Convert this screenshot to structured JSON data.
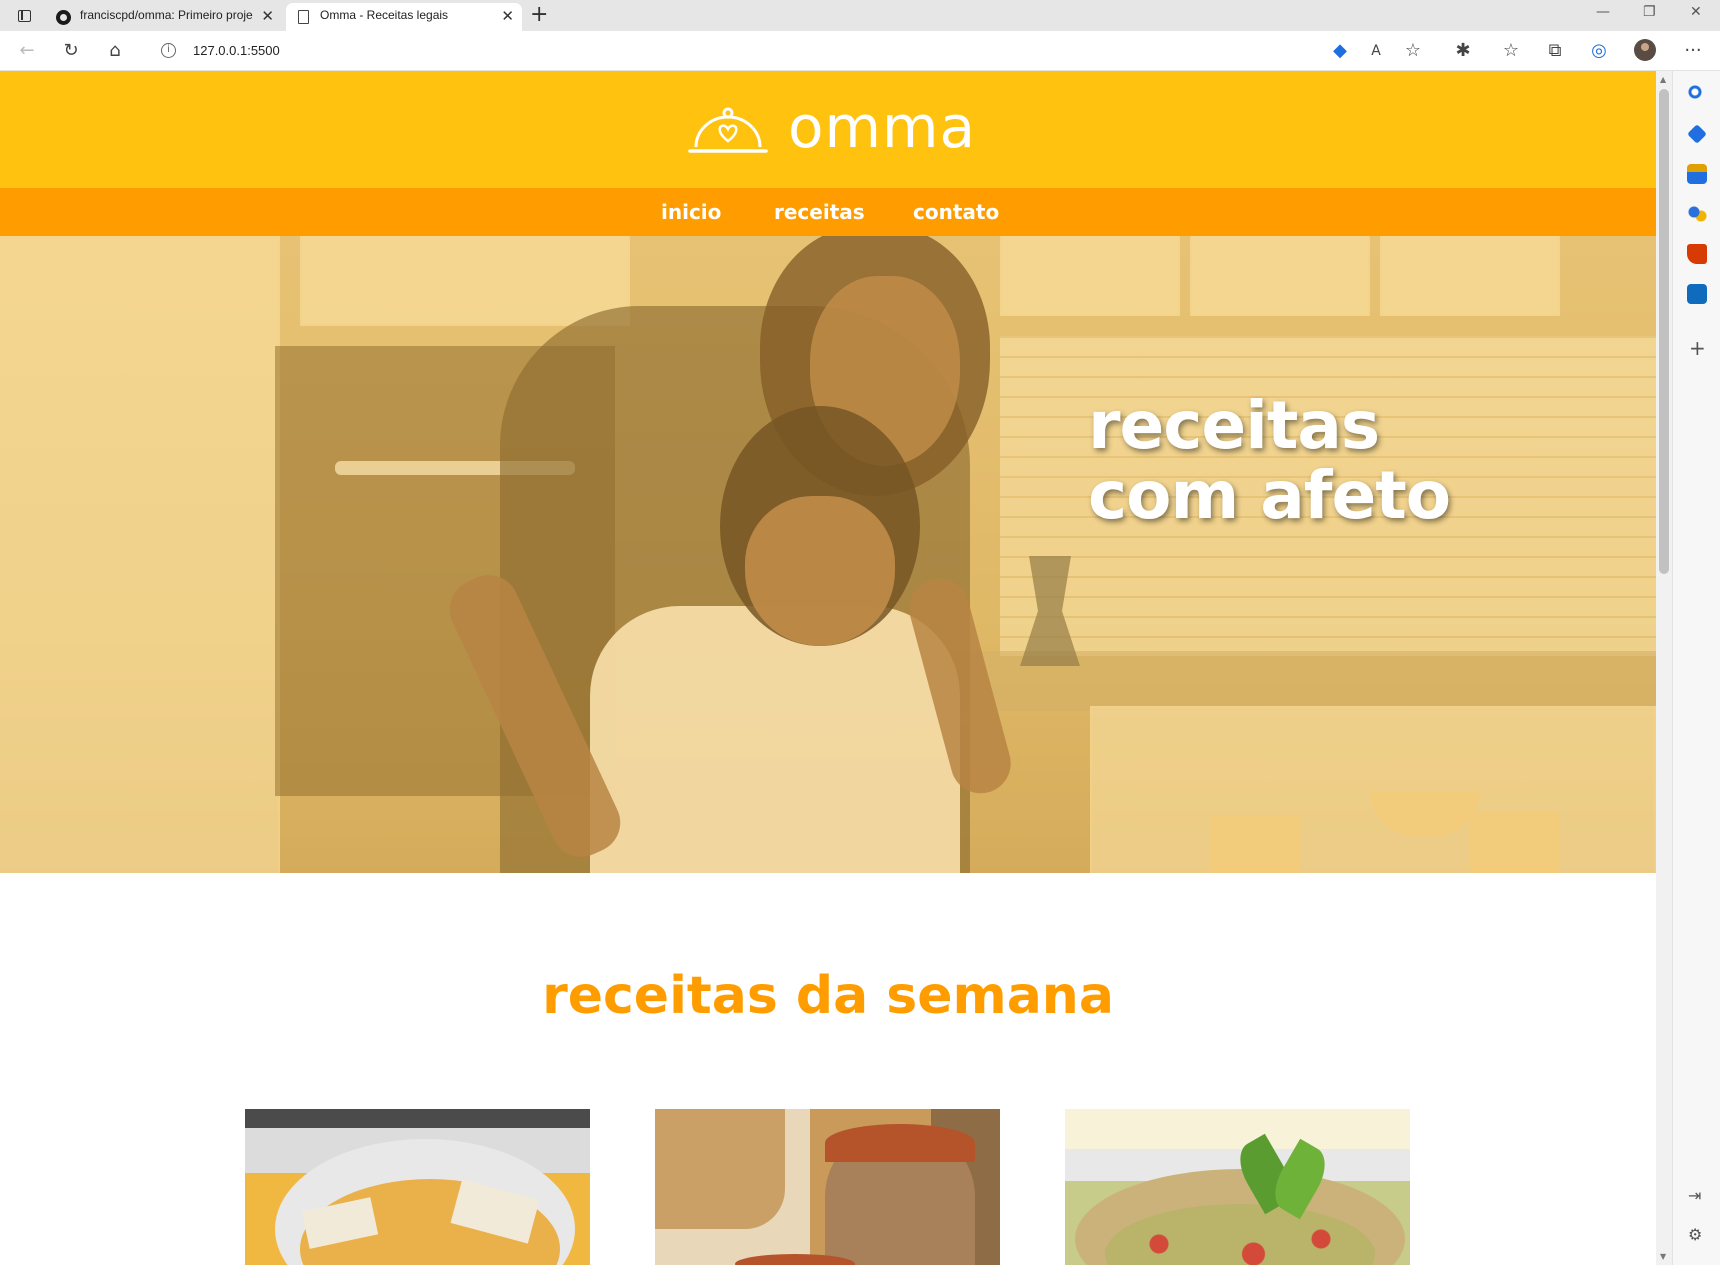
{
  "browser": {
    "tabs": [
      {
        "title": "franciscpd/omma: Primeiro proje",
        "close": "✕"
      },
      {
        "title": "Omma - Receitas legais",
        "close": "✕"
      }
    ],
    "new_tab": "+",
    "window_controls": {
      "minimize": "—",
      "restore": "❐",
      "close": "✕"
    },
    "address": {
      "url": "127.0.0.1:5500",
      "info_icon": "i"
    },
    "toolbar_icons": [
      "back-icon",
      "refresh-icon",
      "home-icon",
      "shopping-tag-icon",
      "read-aloud-icon",
      "add-favorite-icon",
      "extensions-icon",
      "favorites-icon",
      "collections-icon",
      "browser-essentials-icon",
      "profile-avatar",
      "more-icon"
    ],
    "sidebar_icons": [
      "search-icon",
      "shopping-icon",
      "tools-icon",
      "games-icon",
      "office-icon",
      "outlook-icon"
    ],
    "sidebar_plus": "+",
    "more": "···"
  },
  "site": {
    "brand": "omma",
    "nav": [
      {
        "label": "inicio"
      },
      {
        "label": "receitas"
      },
      {
        "label": "contato"
      }
    ],
    "hero": {
      "line1": "receitas",
      "line2": "com afeto"
    },
    "section_title": "receitas da semana",
    "colors": {
      "header": "#ffc20e",
      "nav": "#ff9d00",
      "accent": "#ff9d00"
    }
  }
}
